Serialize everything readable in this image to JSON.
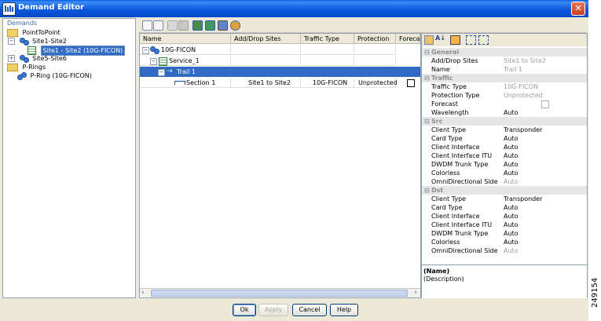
{
  "window": {
    "title": "Demand Editor",
    "close_glyph": "✕"
  },
  "demands": {
    "caption": "Demands",
    "tree": [
      {
        "label": "PointToPoint"
      },
      {
        "label": "Site1-Site2"
      },
      {
        "label": "Site1 - Site2 (10G-FICON)"
      },
      {
        "label": "Site5-Site6"
      },
      {
        "label": "P-Rings"
      },
      {
        "label": "P-Ring (10G-FICON)"
      }
    ]
  },
  "grid": {
    "columns": [
      "Name",
      "Add/Drop Sites",
      "Traffic Type",
      "Protection",
      "Forecast"
    ],
    "rows": [
      {
        "name": "10G-FICON",
        "sites": "",
        "traffic": "",
        "protection": ""
      },
      {
        "name": "Service_1",
        "sites": "",
        "traffic": "",
        "protection": ""
      },
      {
        "name": "Trail 1",
        "sites": "",
        "traffic": "",
        "protection": ""
      },
      {
        "name": "Section 1",
        "sites": "Site1 to Site2",
        "traffic": "10G-FICON",
        "protection": "Unprotected"
      }
    ]
  },
  "properties": {
    "general": {
      "title": "General",
      "rows": [
        {
          "name": "Add/Drop Sites",
          "value": "Site1 to Site2"
        },
        {
          "name": "Name",
          "value": "Trail 1"
        }
      ]
    },
    "traffic": {
      "title": "Traffic",
      "rows": [
        {
          "name": "Traffic Type",
          "value": "10G-FICON"
        },
        {
          "name": "Protection Type",
          "value": "Unprotected"
        },
        {
          "name": "Forecast",
          "value": ""
        },
        {
          "name": "Wavelength",
          "value": "Auto"
        }
      ]
    },
    "src": {
      "title": "Src",
      "rows": [
        {
          "name": "Client Type",
          "value": "Transponder"
        },
        {
          "name": "Card Type",
          "value": "Auto"
        },
        {
          "name": "Client Interface",
          "value": "Auto"
        },
        {
          "name": "Client Interface ITU",
          "value": "Auto"
        },
        {
          "name": "DWDM Trunk Type",
          "value": "Auto"
        },
        {
          "name": "Colorless",
          "value": "Auto"
        },
        {
          "name": "OmniDirectional Side",
          "value": "Auto"
        }
      ]
    },
    "dst": {
      "title": "Dst",
      "rows": [
        {
          "name": "Client Type",
          "value": "Transponder"
        },
        {
          "name": "Card Type",
          "value": "Auto"
        },
        {
          "name": "Client Interface",
          "value": "Auto"
        },
        {
          "name": "Client Interface ITU",
          "value": "Auto"
        },
        {
          "name": "DWDM Trunk Type",
          "value": "Auto"
        },
        {
          "name": "Colorless",
          "value": "Auto"
        },
        {
          "name": "OmniDirectional Side",
          "value": "Auto"
        }
      ]
    },
    "description": {
      "name": "(Name)",
      "text": "(Description)"
    }
  },
  "buttons": {
    "ok": "Ok",
    "apply": "Apply",
    "cancel": "Cancel",
    "help": "Help"
  },
  "figure_id": "249154",
  "colors": {
    "selection": "#316ac5",
    "titlebar": "#0a5fe8"
  }
}
